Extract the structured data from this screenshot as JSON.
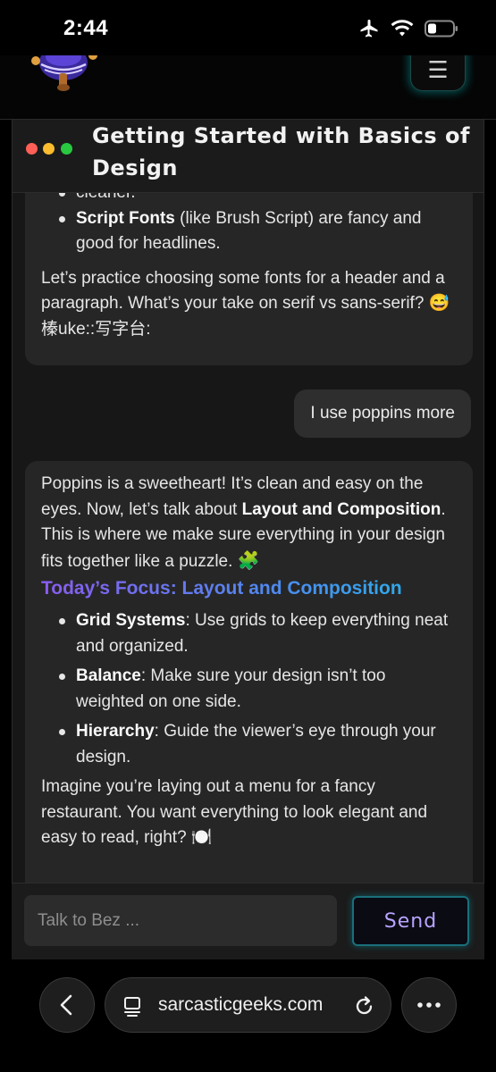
{
  "status_bar": {
    "time": "2:44",
    "icons": [
      "airplane-icon",
      "wifi-icon",
      "battery-icon"
    ]
  },
  "header": {
    "logo": "mascot-logo",
    "menu_icon": "☰"
  },
  "chat": {
    "title": "Getting Started with Basics of Design",
    "messages": [
      {
        "role": "bot",
        "fragment_top": "cleaner.",
        "bullets": [
          {
            "bold": "Script Fonts",
            "text": " (like Brush Script) are fancy and good for headlines."
          }
        ],
        "paragraph": "Let’s practice choosing some fonts for a header and a paragraph. What’s your take on serif vs sans-serif? 😅 榛uke::写字台:"
      },
      {
        "role": "user",
        "text": "I use poppins more"
      },
      {
        "role": "bot",
        "intro_1": "Poppins is a sweetheart! It’s clean and easy on the eyes. Now, let’s talk about ",
        "intro_bold": "Layout and Composition",
        "intro_2": ". This is where we make sure everything in your design fits together like a puzzle.",
        "puzzle_emoji": "🧩",
        "heading": "Today’s Focus: Layout and Composition",
        "bullets": [
          {
            "bold": "Grid Systems",
            "text": ": Use grids to keep everything neat and organized."
          },
          {
            "bold": "Balance",
            "text": ": Make sure your design isn’t too weighted on one side."
          },
          {
            "bold": "Hierarchy",
            "text": ": Guide the viewer’s eye through your design."
          }
        ],
        "closing": "Imagine you’re laying out a menu for a fancy restaurant. You want everything to look elegant and easy to read, right? 🍽️"
      }
    ],
    "input_placeholder": "Talk to Bez ...",
    "send_label": "Send"
  },
  "browser": {
    "url": "sarcasticgeeks.com",
    "icons": [
      "back-icon",
      "page-icon",
      "reload-icon",
      "more-icon"
    ]
  },
  "colors": {
    "bubble": "#262626",
    "heading_gradient_start": "#8a5cf0",
    "heading_gradient_end": "#22b7e8",
    "send_text": "#b9a3ff"
  }
}
